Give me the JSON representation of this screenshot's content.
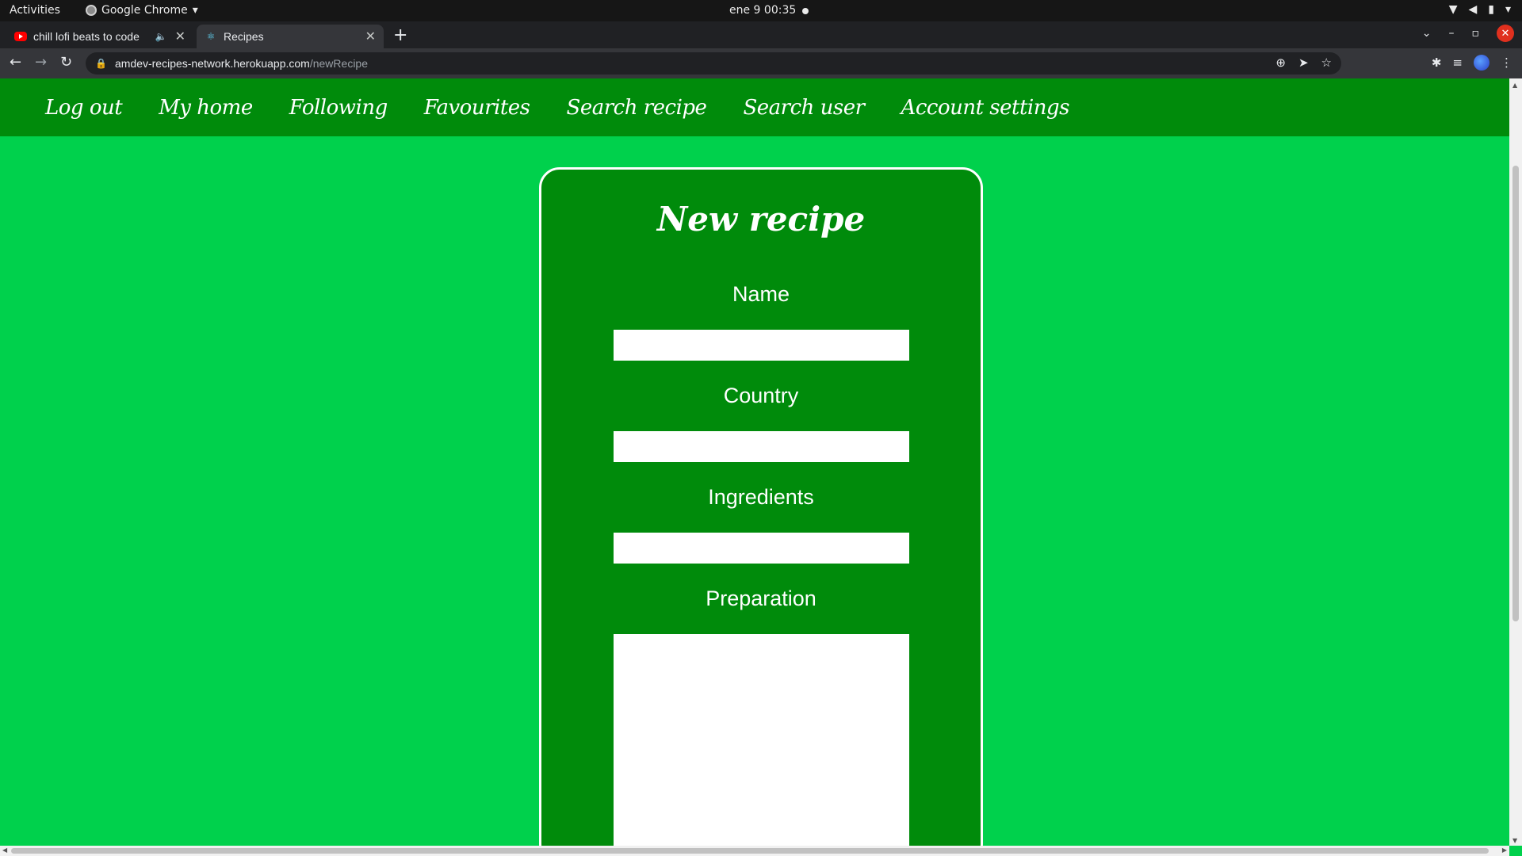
{
  "os_bar": {
    "activities": "Activities",
    "app_name": "Google Chrome",
    "clock": "ene 9  00:35"
  },
  "browser": {
    "tabs": [
      {
        "title": "chill lofi beats to code",
        "favicon": "youtube-icon",
        "audio": true
      },
      {
        "title": "Recipes",
        "favicon": "react-icon",
        "active": true
      }
    ],
    "url_host": "amdev-recipes-network.herokuapp.com",
    "url_path": "/newRecipe"
  },
  "nav": {
    "items": [
      "Log out",
      "My home",
      "Following",
      "Favourites",
      "Search recipe",
      "Search user",
      "Account settings"
    ]
  },
  "form": {
    "title": "New recipe",
    "name_label": "Name",
    "name_value": "",
    "country_label": "Country",
    "country_value": "",
    "ingredients_label": "Ingredients",
    "ingredients_value": "",
    "preparation_label": "Preparation",
    "preparation_value": ""
  },
  "colors": {
    "page_bg": "#00d14c",
    "nav_bg": "#008b0b",
    "card_bg": "#008b0b",
    "card_border": "#ffffff"
  }
}
